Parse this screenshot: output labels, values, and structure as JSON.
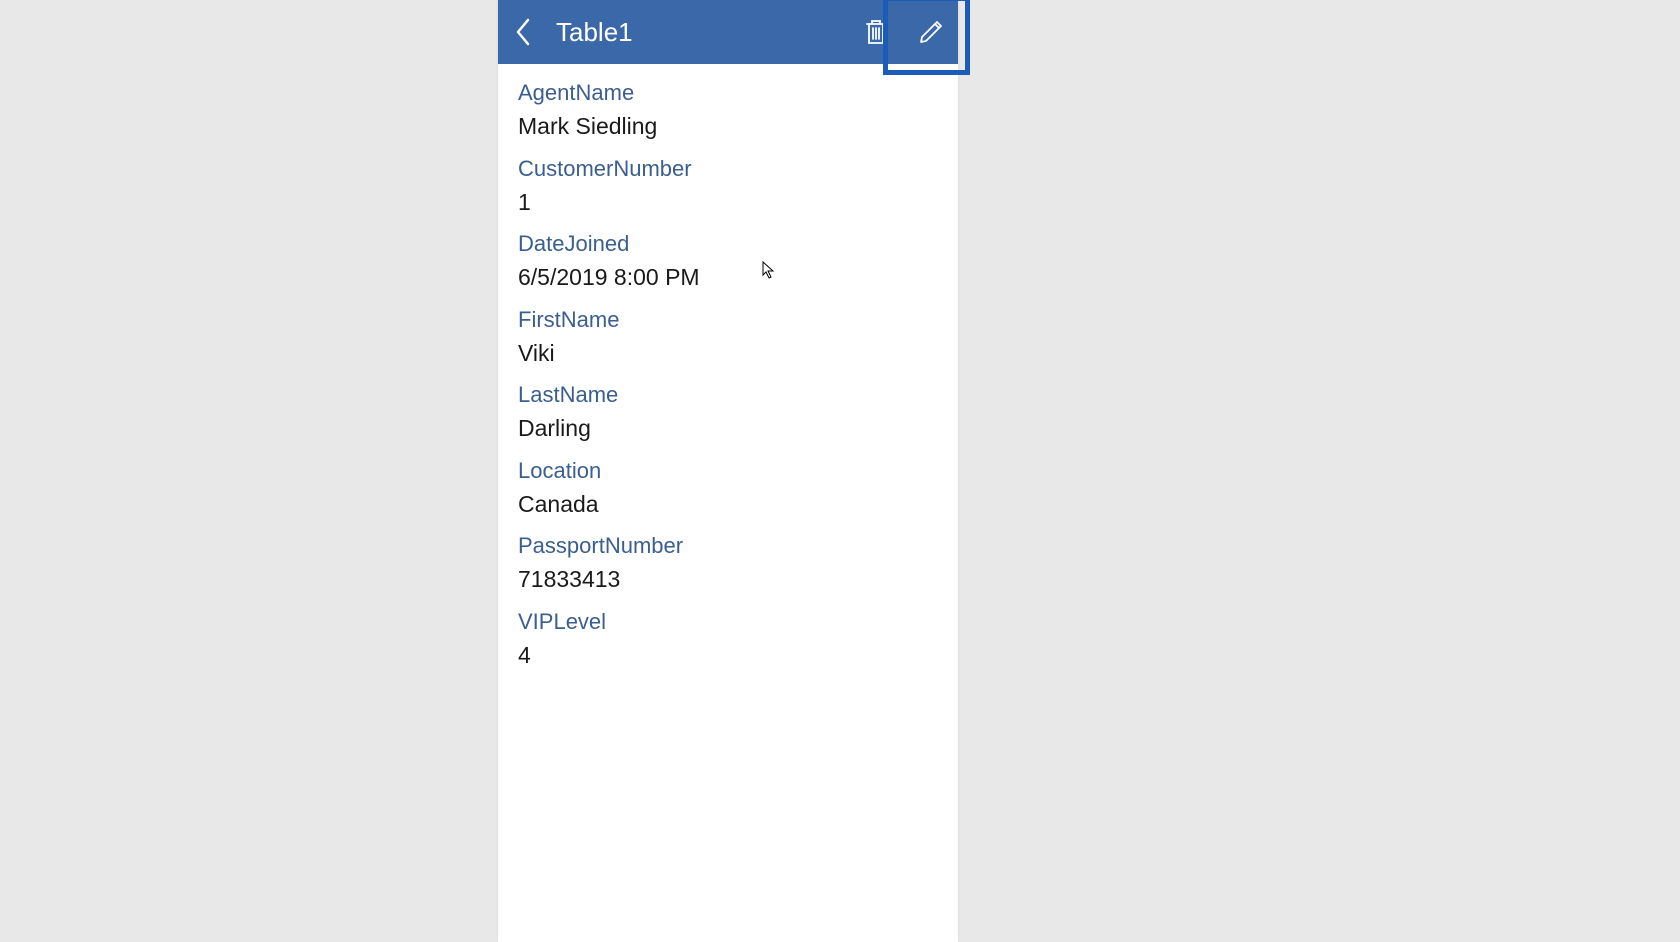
{
  "header": {
    "title": "Table1"
  },
  "fields": [
    {
      "label": "AgentName",
      "value": "Mark Siedling"
    },
    {
      "label": "CustomerNumber",
      "value": "1"
    },
    {
      "label": "DateJoined",
      "value": "6/5/2019 8:00 PM"
    },
    {
      "label": "FirstName",
      "value": "Viki"
    },
    {
      "label": "LastName",
      "value": "Darling"
    },
    {
      "label": "Location",
      "value": "Canada"
    },
    {
      "label": "PassportNumber",
      "value": "71833413"
    },
    {
      "label": "VIPLevel",
      "value": "4"
    }
  ]
}
